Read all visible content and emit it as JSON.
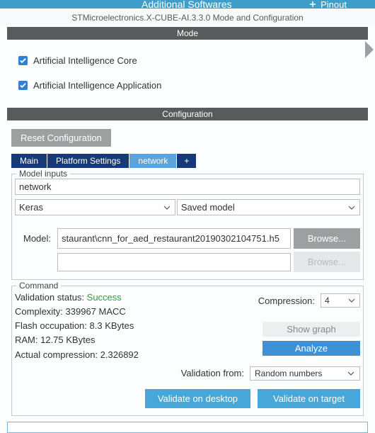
{
  "topbar": {
    "title": "Additional Softwares",
    "pinout": "Pinout"
  },
  "subtitle": "STMicroelectronics.X-CUBE-AI.3.3.0 Mode and Configuration",
  "bands": {
    "mode": "Mode",
    "config": "Configuration"
  },
  "mode": {
    "check1": "Artificial Intelligence Core",
    "check2": "Artificial Intelligence Application"
  },
  "buttons": {
    "reset": "Reset Configuration",
    "browse": "Browse...",
    "showgraph": "Show graph",
    "analyze": "Analyze",
    "valdesktop": "Validate on desktop",
    "valtarget": "Validate on target",
    "plus": "+"
  },
  "tabs": {
    "main": "Main",
    "platform": "Platform Settings",
    "network": "network"
  },
  "modelInputs": {
    "legend": "Model inputs",
    "name": "network",
    "framework": "Keras",
    "modelType": "Saved model",
    "modelLabel": "Model:",
    "modelPath": "staurant\\cnn_for_aed_restaurant20190302104751.h5"
  },
  "command": {
    "legend": "Command",
    "lines": {
      "status_label": "Validation status: ",
      "status_value": "Success",
      "complexity": "Complexity: 339967 MACC",
      "flash": "Flash occupation: 8.3 KBytes",
      "ram": "RAM: 12.75 KBytes",
      "actual": "Actual compression: 2.326892"
    },
    "compression_label": "Compression:",
    "compression_value": "4",
    "valfrom_label": "Validation from:",
    "valfrom_value": "Random numbers"
  }
}
